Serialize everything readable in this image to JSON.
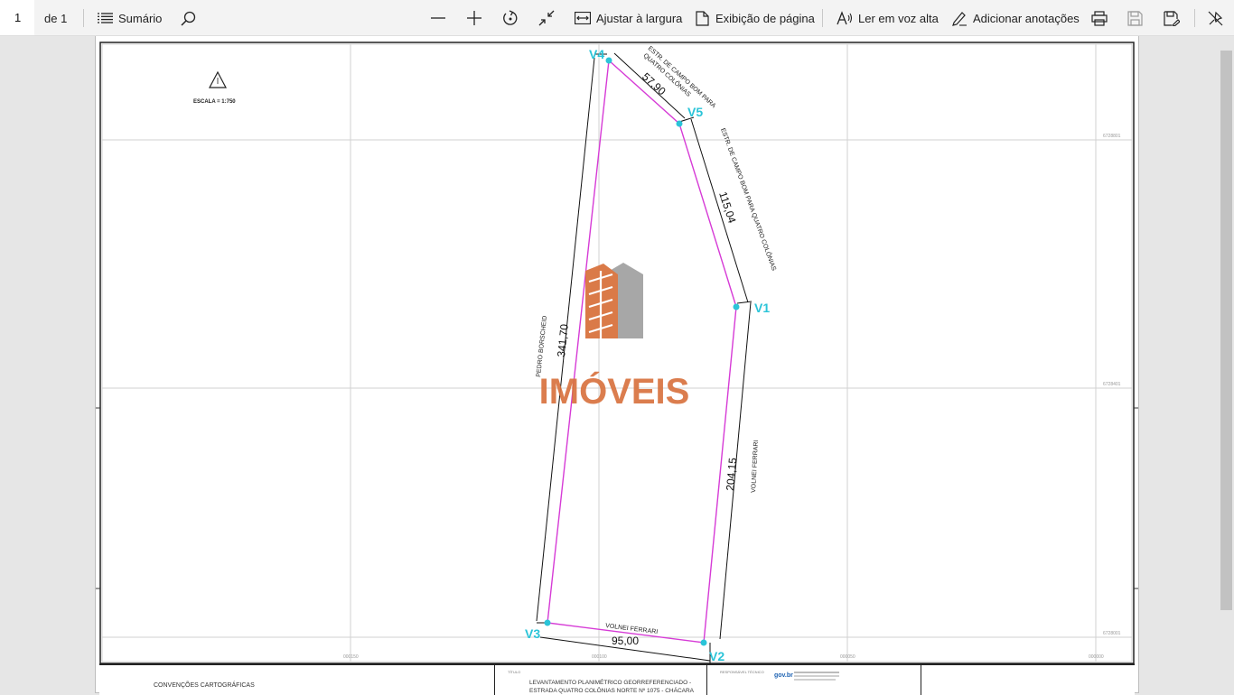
{
  "toolbar": {
    "page_number": "1",
    "page_total": "de 1",
    "summary": "Sumário",
    "fit_width": "Ajustar à largura",
    "page_view": "Exibição de página",
    "read_aloud": "Ler em voz alta",
    "add_notes": "Adicionar anotações"
  },
  "map": {
    "scale": "ESCALA  =  1:750",
    "vertices": [
      "V1",
      "V2",
      "V3",
      "V4",
      "V5"
    ],
    "distances": {
      "v4_v5": "57,90",
      "v5_v1": "115,04",
      "v1_v2": "204,15",
      "v2_v3": "95,00",
      "v3_v4": "341,70"
    },
    "neighbors": {
      "road_top_line1": "ESTR. DE CAMPO BOM PARA",
      "road_top_line2": "QUATRO COLÔNIAS",
      "road_right": "ESTR. DE CAMPO BOM PARA QUATRO COLÔNIAS",
      "right": "VOLNEI FERRARI",
      "bottom": "VOLNEI FERRARI",
      "left": "PEDRO BORSCHEID"
    },
    "grid_labels": {
      "n1": "6728801",
      "n2": "6728401",
      "n3": "6728001",
      "e1": "000150",
      "e2": "000100",
      "e3": "000050",
      "e4": "000000"
    }
  },
  "watermark": {
    "text": "IMÓVEIS"
  },
  "title_block": {
    "conventions": "CONVENÇÕES CARTOGRÁFICAS",
    "title_label": "TÍTULO",
    "title_line1": "LEVANTAMENTO PLANIMÉTRICO GEORREFERENCIADO -",
    "title_line2": "ESTRADA QUATRO COLÔNIAS NORTE Nº 1075 - CHÁCARA",
    "responsible_label": "RESPONSÁVEL TÉCNICO",
    "logo": "gov.br"
  },
  "colors": {
    "parcel": "#d63bd6",
    "vertex": "#2bc4d8",
    "watermark": "#d9733f",
    "watermark_grey": "#9a9a9a"
  }
}
